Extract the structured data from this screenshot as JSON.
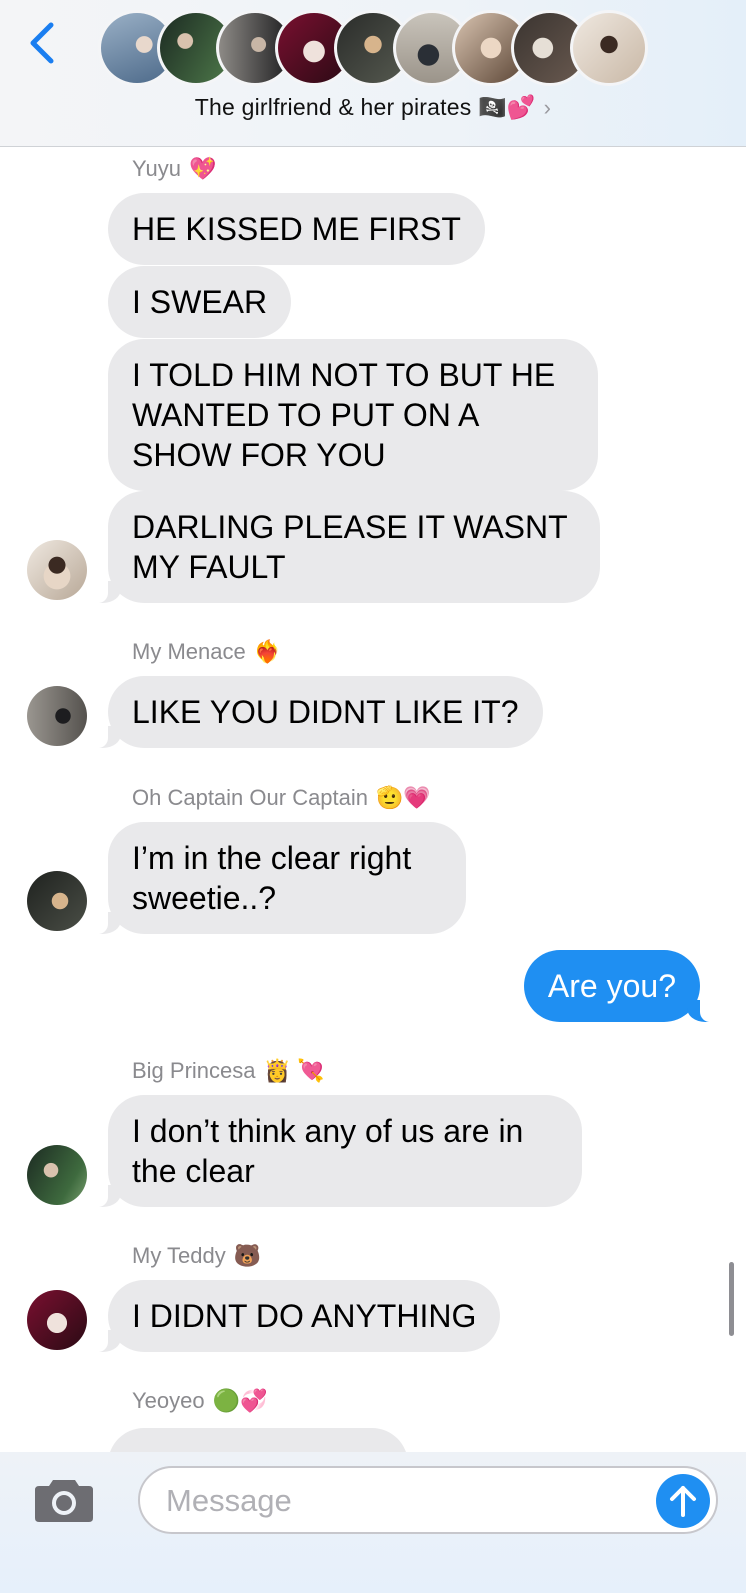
{
  "header": {
    "group_name": "The girlfriend & her pirates 🏴‍☠️💕",
    "chevron": "›",
    "avatars": [
      {
        "name": "avatar-1",
        "colors": [
          "#4d6a8a",
          "#9ab0c6"
        ]
      },
      {
        "name": "avatar-2",
        "colors": [
          "#1c2a22",
          "#4e7a4a"
        ]
      },
      {
        "name": "avatar-3",
        "colors": [
          "#8d8a86",
          "#1d1d1f"
        ]
      },
      {
        "name": "avatar-4",
        "colors": [
          "#7a1030",
          "#e8e0e0"
        ]
      },
      {
        "name": "avatar-5",
        "colors": [
          "#2a2c2a",
          "#c9a680"
        ]
      },
      {
        "name": "avatar-6",
        "colors": [
          "#c9c4bb",
          "#2a2f36"
        ]
      },
      {
        "name": "avatar-7",
        "colors": [
          "#d8c3b0",
          "#5a4434"
        ]
      },
      {
        "name": "avatar-8",
        "colors": [
          "#3a3430",
          "#e6dfd6"
        ]
      },
      {
        "name": "avatar-9",
        "colors": [
          "#efe8e0",
          "#3b2a22"
        ]
      }
    ]
  },
  "messages": {
    "yuyu": {
      "sender": "Yuyu",
      "sender_emoji": "💖",
      "m1": "HE KISSED ME FIRST",
      "m2": "I SWEAR",
      "m3_l1": "I TOLD HIM NOT TO BUT HE",
      "m3_l2": "WANTED TO PUT ON A",
      "m3_l3": "SHOW FOR YOU",
      "m4_l1": "DARLING PLEASE IT WASNT",
      "m4_l2": "MY FAULT"
    },
    "menace": {
      "sender": "My Menace",
      "sender_emoji": "❤️‍🔥",
      "m1": "LIKE YOU DIDNT LIKE IT?"
    },
    "captain": {
      "sender": "Oh Captain Our Captain",
      "sender_emoji": "🫡💗",
      "m1_l1": "I’m in the clear right",
      "m1_l2": "sweetie..?"
    },
    "outgoing": {
      "m1": "Are you?"
    },
    "princesa": {
      "sender": "Big Princesa",
      "sender_emoji": "👸 💘",
      "m1_l1": "I don’t think any of us are in",
      "m1_l2": "the clear"
    },
    "teddy": {
      "sender": "My Teddy",
      "sender_emoji": "🐻",
      "m1": "I DIDNT DO ANYTHING"
    },
    "yeoyeo": {
      "sender": "Yeoyeo",
      "sender_emoji": "🟢💞"
    }
  },
  "composer": {
    "placeholder": "Message"
  },
  "colors": {
    "incoming_bubble": "#e9e9eb",
    "outgoing_bubble": "#1f8ff2",
    "accent": "#1a7ef0"
  }
}
